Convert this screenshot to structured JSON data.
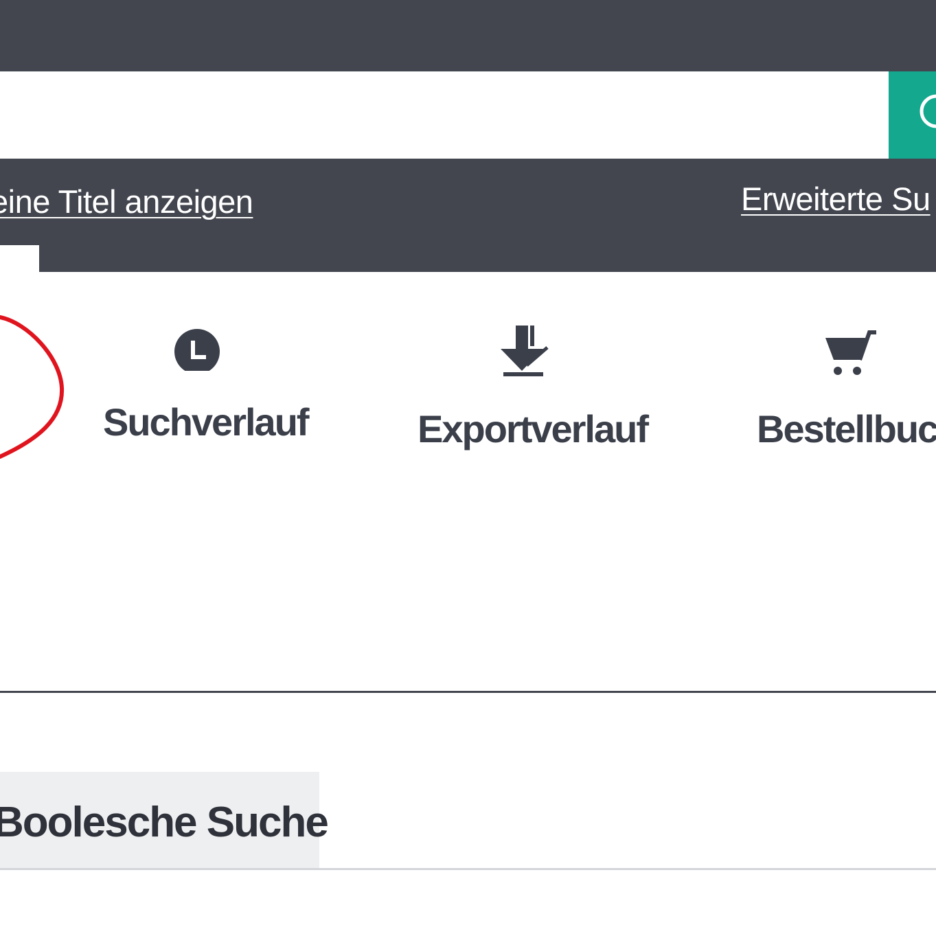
{
  "header": {
    "background_color": "#43464f"
  },
  "search": {
    "input_value": "",
    "button_icon": "search-icon",
    "button_color": "#14a88f"
  },
  "subnav": {
    "left_link": "eine Titel anzeigen",
    "right_link": "Erweiterte Su"
  },
  "tools": [
    {
      "label": "Suchverlauf",
      "icon": "clock-icon"
    },
    {
      "label": "Exportverlauf",
      "icon": "download-icon"
    },
    {
      "label": "Bestellbuch",
      "icon": "cart-icon"
    }
  ],
  "tabs": {
    "boolean_search": "Boolesche Suche"
  },
  "annotation": {
    "color": "#e0141e"
  }
}
